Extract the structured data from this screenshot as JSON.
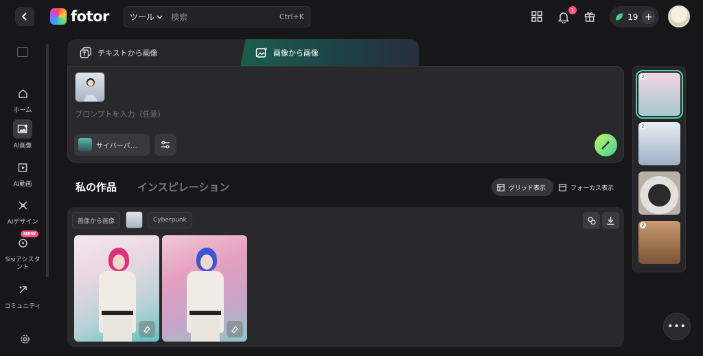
{
  "header": {
    "brand": "fotor",
    "search": {
      "tool_label": "ツール",
      "placeholder": "検索",
      "shortcut": "Ctrl+K"
    },
    "notifications_count": "1",
    "credits": "19"
  },
  "sidebar": {
    "items": [
      {
        "label": "ホーム",
        "icon": "home-icon"
      },
      {
        "label": "AI画像",
        "icon": "ai-image-icon",
        "active": true
      },
      {
        "label": "AI動画",
        "icon": "ai-video-icon"
      },
      {
        "label": "AIデザイン",
        "icon": "ai-design-icon"
      },
      {
        "label": "Sisiアシスタント",
        "icon": "assistant-icon",
        "badge": "NEW"
      },
      {
        "label": "コミュニティ",
        "icon": "community-icon"
      }
    ]
  },
  "tabs": [
    {
      "label": "テキストから画像"
    },
    {
      "label": "画像から画像",
      "active": true
    }
  ],
  "prompt": {
    "placeholder": "プロンプトを入力（任意）",
    "style_chip": "サイバーパ…"
  },
  "section": {
    "my_works": "私の作品",
    "inspiration": "インスピレーション",
    "grid_view": "グリッド表示",
    "focus_view": "フォーカス表示"
  },
  "result": {
    "mode_tag": "画像から画像",
    "style_tag": "Cyberpunk"
  },
  "history": {
    "items": [
      {
        "num": "2"
      },
      {
        "num": "2"
      },
      {
        "num": ""
      },
      {
        "num": "2"
      }
    ]
  },
  "colors": {
    "accent": "#4ad7a0",
    "badge": "#ff4d79",
    "background": "#17171a"
  }
}
